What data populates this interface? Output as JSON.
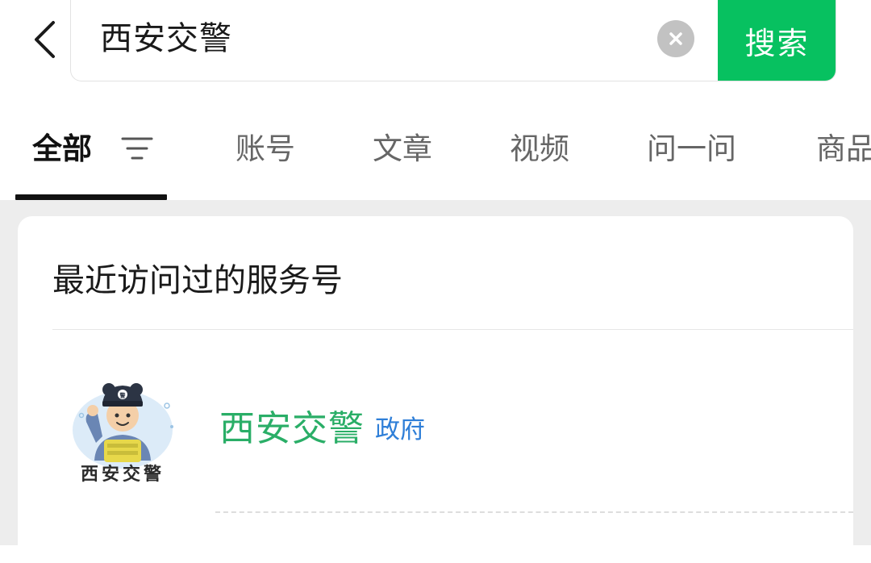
{
  "search": {
    "query": "西安交警",
    "button_label": "搜索"
  },
  "tabs": [
    {
      "label": "全部",
      "active": true
    },
    {
      "label": "账号"
    },
    {
      "label": "文章"
    },
    {
      "label": "视频"
    },
    {
      "label": "问一问"
    },
    {
      "label": "商品"
    }
  ],
  "section": {
    "title": "最近访问过的服务号"
  },
  "results": [
    {
      "name": "西安交警",
      "badge": "政府",
      "avatar_caption": "西安交警",
      "avatar_badge_glyph": "警"
    }
  ],
  "colors": {
    "accent_green": "#07c160",
    "result_name": "#2aae67",
    "badge_blue": "#2f7fd8",
    "background": "#ededed"
  }
}
